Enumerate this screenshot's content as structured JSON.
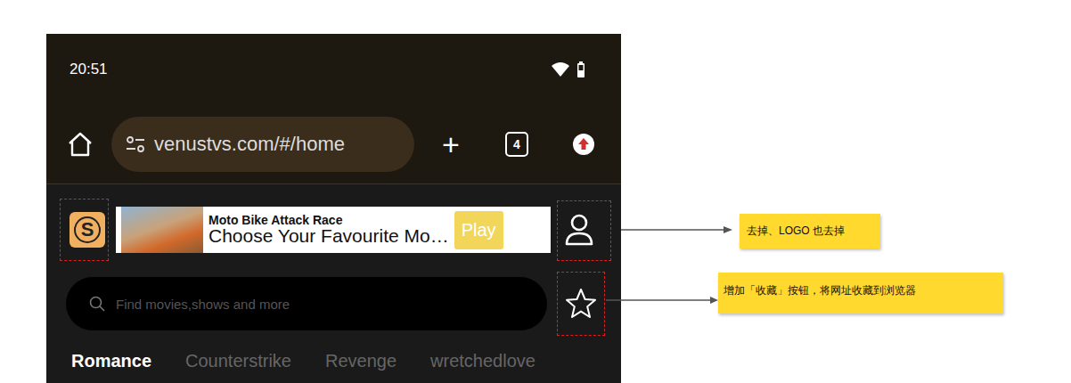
{
  "status_bar": {
    "time": "20:51"
  },
  "browser": {
    "url": "venustvs.com/#/home",
    "new_tab": "+",
    "tab_count": "4"
  },
  "logo": {
    "letter": "S"
  },
  "ad": {
    "title": "Moto Bike Attack Race",
    "text": "Choose Your Favourite Mo…",
    "button": "Play"
  },
  "search": {
    "placeholder": "Find movies,shows and more"
  },
  "categories": [
    {
      "label": "Romance",
      "selected": true
    },
    {
      "label": "Counterstrike",
      "selected": false
    },
    {
      "label": "Revenge",
      "selected": false
    },
    {
      "label": "wretchedlove",
      "selected": false
    }
  ],
  "annotations": [
    {
      "text": "去掉、LOGO 也去掉"
    },
    {
      "text": "增加「收藏」按钮，将网址收藏到浏览器"
    }
  ]
}
